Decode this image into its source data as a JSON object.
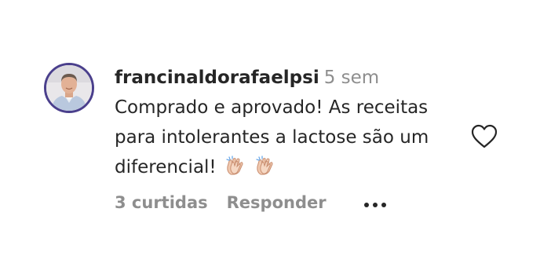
{
  "comment": {
    "username": "francinaldorafaelpsi",
    "time": "5 sem",
    "text_lines": [
      "Comprado e aprovado! As receitas",
      "para intolerantes a lactose são um",
      "diferencial!"
    ],
    "emojis": [
      "clapping-hands-icon",
      "clapping-hands-icon"
    ],
    "likes_label": "3 curtidas",
    "reply_label": "Responder",
    "more_icon": "more-options-icon",
    "like_icon": "heart-outline-icon"
  },
  "colors": {
    "text": "#262626",
    "muted": "#8e8e8e",
    "avatar_ring": "#4a3f8c"
  }
}
